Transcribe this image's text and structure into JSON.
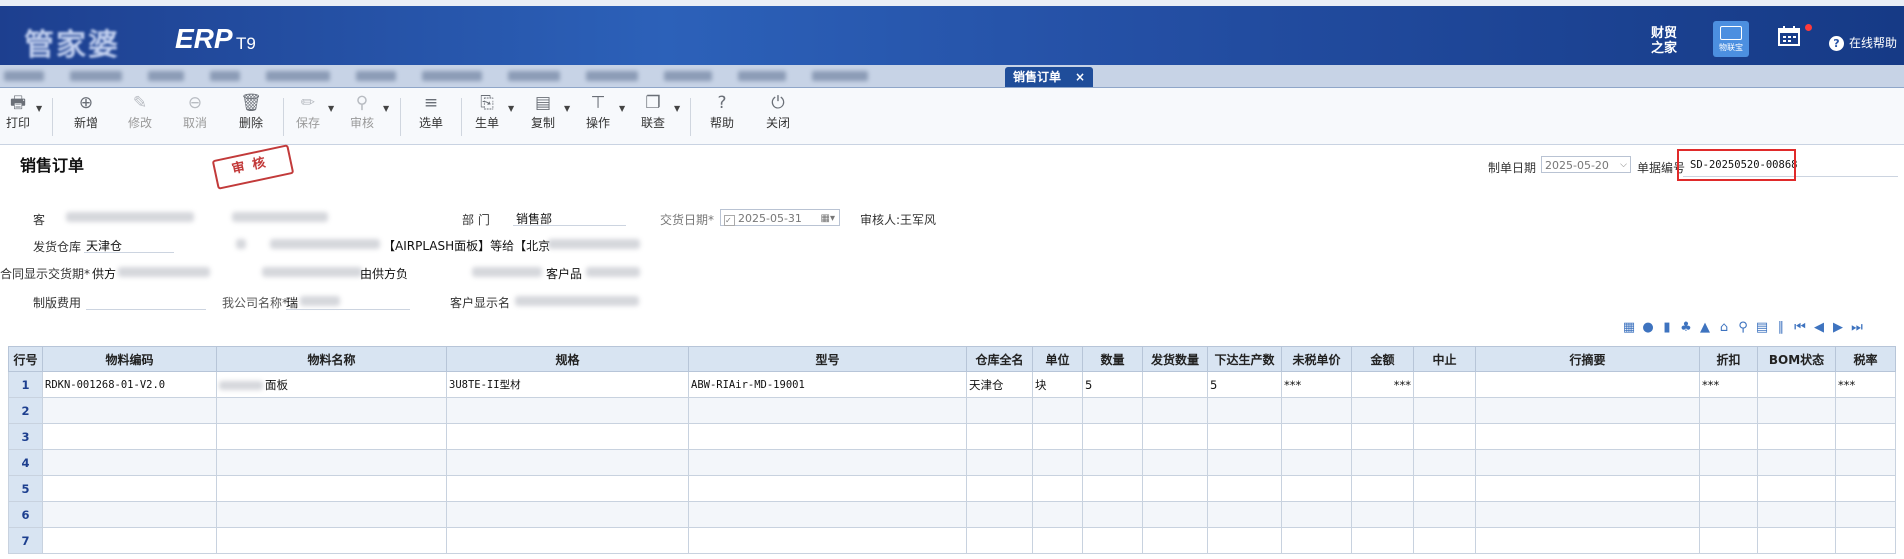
{
  "app": {
    "logo_blurred": "管家婆",
    "brand": "ERP",
    "brand_version": "T9",
    "caiwu_label_1": "财贸",
    "caiwu_label_2": "之家",
    "wulianbao_label": "物联宝",
    "help_label": "在线帮助"
  },
  "tabs": {
    "active_label": "销售订单",
    "close_glyph": "×"
  },
  "toolbar": [
    {
      "label": "打印",
      "icon": "printer-icon",
      "glyph": "🖶",
      "enabled": true,
      "dropdown": true
    },
    {
      "label": "新增",
      "icon": "add-icon",
      "glyph": "⊕",
      "enabled": true
    },
    {
      "label": "修改",
      "icon": "edit-icon",
      "glyph": "✎",
      "enabled": false
    },
    {
      "label": "取消",
      "icon": "cancel-icon",
      "glyph": "⊖",
      "enabled": false
    },
    {
      "label": "删除",
      "icon": "trash-icon",
      "glyph": "🗑",
      "enabled": true
    },
    {
      "label": "保存",
      "icon": "save-icon",
      "glyph": "✏",
      "enabled": false,
      "dropdown": true
    },
    {
      "label": "审核",
      "icon": "audit-icon",
      "glyph": "⚲",
      "enabled": false,
      "dropdown": true
    },
    {
      "label": "选单",
      "icon": "select-order-icon",
      "glyph": "≡",
      "enabled": true
    },
    {
      "label": "生单",
      "icon": "generate-order-icon",
      "glyph": "⎘",
      "enabled": true,
      "dropdown": true
    },
    {
      "label": "复制",
      "icon": "copy-icon",
      "glyph": "▤",
      "enabled": true,
      "dropdown": true
    },
    {
      "label": "操作",
      "icon": "operate-icon",
      "glyph": "⊤",
      "enabled": true,
      "dropdown": true
    },
    {
      "label": "联查",
      "icon": "query-icon",
      "glyph": "❐",
      "enabled": true,
      "dropdown": true
    },
    {
      "label": "帮助",
      "icon": "help-icon",
      "glyph": "?",
      "enabled": true
    },
    {
      "label": "关闭",
      "icon": "power-icon",
      "glyph": "⏻",
      "enabled": true
    }
  ],
  "form": {
    "title": "销售订单",
    "stamp": "审核",
    "make_date_label": "制单日期",
    "make_date": "2025-05-20",
    "bill_no_label": "单据编号",
    "bill_no": "SD-20250520-00868",
    "customer_label": "客",
    "department_label": "部  门",
    "department": "销售部",
    "delivery_date_label": "交货日期*",
    "delivery_date": "2025-05-31",
    "auditor": "审核人:王军风",
    "warehouse_label": "发货仓库",
    "warehouse": "天津仓",
    "note_fragment": "【AIRPLASH面板】等给【北京",
    "contract_label": "合同显示交货期*",
    "contract_fragment": "供方",
    "supplier_fragment": "由供方负",
    "customer_product_fragment": "客户品",
    "plate_fee_label": "制版费用",
    "company_label": "我公司名称*",
    "company_fragment": "瑞",
    "customer_display_label": "客户显示名"
  },
  "grid": {
    "columns": [
      "行号",
      "物料编码",
      "物料名称",
      "规格",
      "型号",
      "仓库全名",
      "单位",
      "数量",
      "发货数量",
      "下达生产数",
      "未税单价",
      "金额",
      "中止",
      "行摘要",
      "折扣",
      "BOM状态",
      "税率"
    ],
    "rows": [
      {
        "no": "1",
        "code": "RDKN-001268-01-V2.0",
        "name": "面板",
        "spec": "3U8TE-II型材",
        "model": "ABW-RIAir-MD-19001",
        "warehouse": "天津仓",
        "unit": "块",
        "qty": "5",
        "ship_qty": "",
        "prod_qty": "5",
        "price": "***",
        "amount": "***",
        "stop": "",
        "memo": "",
        "discount": "***",
        "bom": "",
        "tax": "***"
      },
      {
        "no": "2"
      },
      {
        "no": "3"
      },
      {
        "no": "4"
      },
      {
        "no": "5"
      },
      {
        "no": "6"
      },
      {
        "no": "7"
      }
    ]
  }
}
